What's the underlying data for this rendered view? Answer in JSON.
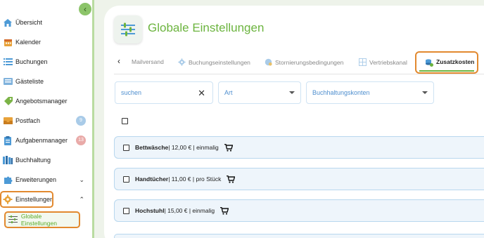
{
  "sidebar": {
    "items": [
      {
        "label": "Übersicht",
        "icon": "home-icon"
      },
      {
        "label": "Kalender",
        "icon": "calendar-icon"
      },
      {
        "label": "Buchungen",
        "icon": "list-icon"
      },
      {
        "label": "Gästeliste",
        "icon": "guest-list-icon"
      },
      {
        "label": "Angebotsmanager",
        "icon": "tag-icon"
      },
      {
        "label": "Postfach",
        "icon": "inbox-icon",
        "badge": "9"
      },
      {
        "label": "Aufgabenmanager",
        "icon": "clipboard-icon",
        "badge": "13"
      },
      {
        "label": "Buchhaltung",
        "icon": "books-icon"
      },
      {
        "label": "Erweiterungen",
        "icon": "puzzle-icon"
      },
      {
        "label": "Einstellungen",
        "icon": "gear-icon"
      }
    ],
    "sub_item": {
      "label": "Globale Einstellungen",
      "icon": "sliders-icon"
    }
  },
  "page": {
    "title": "Globale Einstellungen"
  },
  "tabs": [
    {
      "label": "Mailversand"
    },
    {
      "label": "Buchungseinstellungen"
    },
    {
      "label": "Stornierungsbedingungen"
    },
    {
      "label": "Vertriebskanal"
    },
    {
      "label": "Zusatzkosten",
      "active": true
    }
  ],
  "filters": {
    "search_placeholder": "suchen",
    "type_placeholder": "Art",
    "accounts_placeholder": "Buchhaltungskonten"
  },
  "rows": [
    {
      "name": "Bettwäsche",
      "details": " | 12,00 € | einmalig"
    },
    {
      "name": "Handtücher",
      "details": " | 11,00 € | pro Stück"
    },
    {
      "name": "Hochstuhl",
      "details": " | 15,00 € | einmalig"
    }
  ],
  "colors": {
    "brand_green": "#6cb43f",
    "highlight_orange": "#e2892f",
    "row_border": "#b8d7ee"
  }
}
